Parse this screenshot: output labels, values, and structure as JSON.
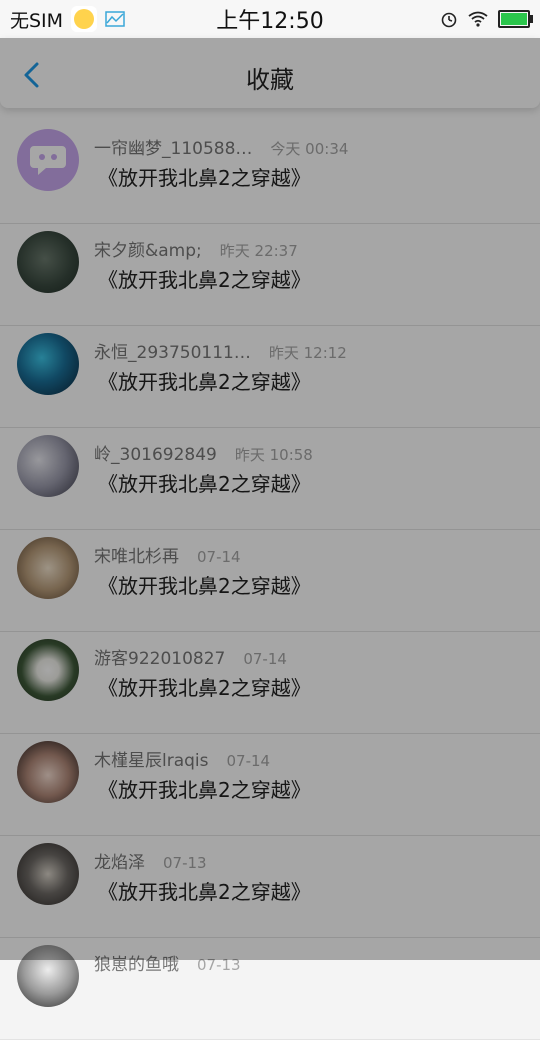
{
  "status_bar": {
    "carrier": "无SIM",
    "time": "上午12:50"
  },
  "nav": {
    "title": "收藏"
  },
  "items": [
    {
      "author": "一帘幽梦_110588…",
      "time": "今天 00:34",
      "title": "《放开我北鼻2之穿越》"
    },
    {
      "author": "宋夕颜&amp;",
      "time": "昨天 22:37",
      "title": "《放开我北鼻2之穿越》"
    },
    {
      "author": "永恒_293750111…",
      "time": "昨天 12:12",
      "title": "《放开我北鼻2之穿越》"
    },
    {
      "author": "岭_301692849",
      "time": "昨天 10:58",
      "title": "《放开我北鼻2之穿越》"
    },
    {
      "author": "宋唯北杉再",
      "time": "07-14",
      "title": "《放开我北鼻2之穿越》"
    },
    {
      "author": "游客922010827",
      "time": "07-14",
      "title": "《放开我北鼻2之穿越》"
    },
    {
      "author": "木槿星辰lraqis",
      "time": "07-14",
      "title": "《放开我北鼻2之穿越》"
    },
    {
      "author": "龙焰泽",
      "time": "07-13",
      "title": "《放开我北鼻2之穿越》"
    },
    {
      "author": "狼崽的鱼哦",
      "time": "07-13",
      "title": ""
    }
  ]
}
